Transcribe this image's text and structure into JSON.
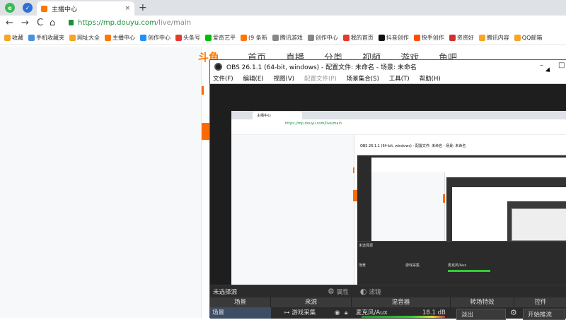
{
  "browser": {
    "tab_title": "主播中心",
    "tab_close": "×",
    "new_tab": "+",
    "url_https": "https://",
    "url_host": "mp.douyu.com",
    "url_path": "/live/main",
    "nav_back": "←",
    "nav_forward": "→",
    "nav_reload": "C",
    "nav_home": "⌂"
  },
  "bookmarks": [
    {
      "label": "收藏",
      "color": "#f5a623"
    },
    {
      "label": "手机收藏夹",
      "color": "#4a90e2"
    },
    {
      "label": "网址大全",
      "color": "#f5a623"
    },
    {
      "label": "主播中心",
      "color": "#ff7700"
    },
    {
      "label": "创作中心",
      "color": "#1e90ff"
    },
    {
      "label": "头条号",
      "color": "#e03c31"
    },
    {
      "label": "爱奇艺平",
      "color": "#00be06"
    },
    {
      "label": "(9 条新",
      "color": "#ff7700"
    },
    {
      "label": "腾讯游戏",
      "color": "#888"
    },
    {
      "label": "创作中心",
      "color": "#888"
    },
    {
      "label": "我的首页",
      "color": "#e03c31"
    },
    {
      "label": "抖音创作",
      "color": "#111"
    },
    {
      "label": "快手创作",
      "color": "#ff5000"
    },
    {
      "label": "资资好",
      "color": "#c33"
    },
    {
      "label": "腾讯内容",
      "color": "#f5a623"
    },
    {
      "label": "QQ邮箱",
      "color": "#f5a623"
    }
  ],
  "douyu_nav": {
    "logo": "斗鱼",
    "links": [
      "首页",
      "直播",
      "分类",
      "视频",
      "游戏",
      "鱼吧"
    ]
  },
  "obs": {
    "title": "OBS 26.1.1 (64-bit, windows) - 配置文件: 未命名 - 场景: 未命名",
    "menu": [
      {
        "label": "文件(F)",
        "disabled": false
      },
      {
        "label": "编辑(E)",
        "disabled": false
      },
      {
        "label": "视图(V)",
        "disabled": false
      },
      {
        "label": "配置文件(P)",
        "disabled": true
      },
      {
        "label": "场景集合(S)",
        "disabled": false
      },
      {
        "label": "工具(T)",
        "disabled": false
      },
      {
        "label": "帮助(H)",
        "disabled": false
      }
    ],
    "win_minimize": "–",
    "win_maximize": "□",
    "no_source_selected": "未选择源",
    "properties_btn": "属性",
    "filters_btn": "滤镜",
    "columns": [
      "场景",
      "来源",
      "混音器",
      "转场特效",
      "控件"
    ],
    "scene_item": "场景",
    "source_item": "游戏采集",
    "mixer_track": "麦克风/Aux",
    "mixer_db": "18.1 dB",
    "transition_value": "淡出",
    "control_btn": "开始推流"
  },
  "nested": {
    "tab_title": "主播中心",
    "url": "https://mp.douyu.com/live/main",
    "obs_title": "OBS 26.1.1 (64-bit, windows) - 配置文件: 未命名 - 场景: 未命名",
    "dock_label": "未选择源",
    "scene_item": "场景",
    "source_item": "游戏采集",
    "mixer_track": "麦克风/Aux"
  }
}
